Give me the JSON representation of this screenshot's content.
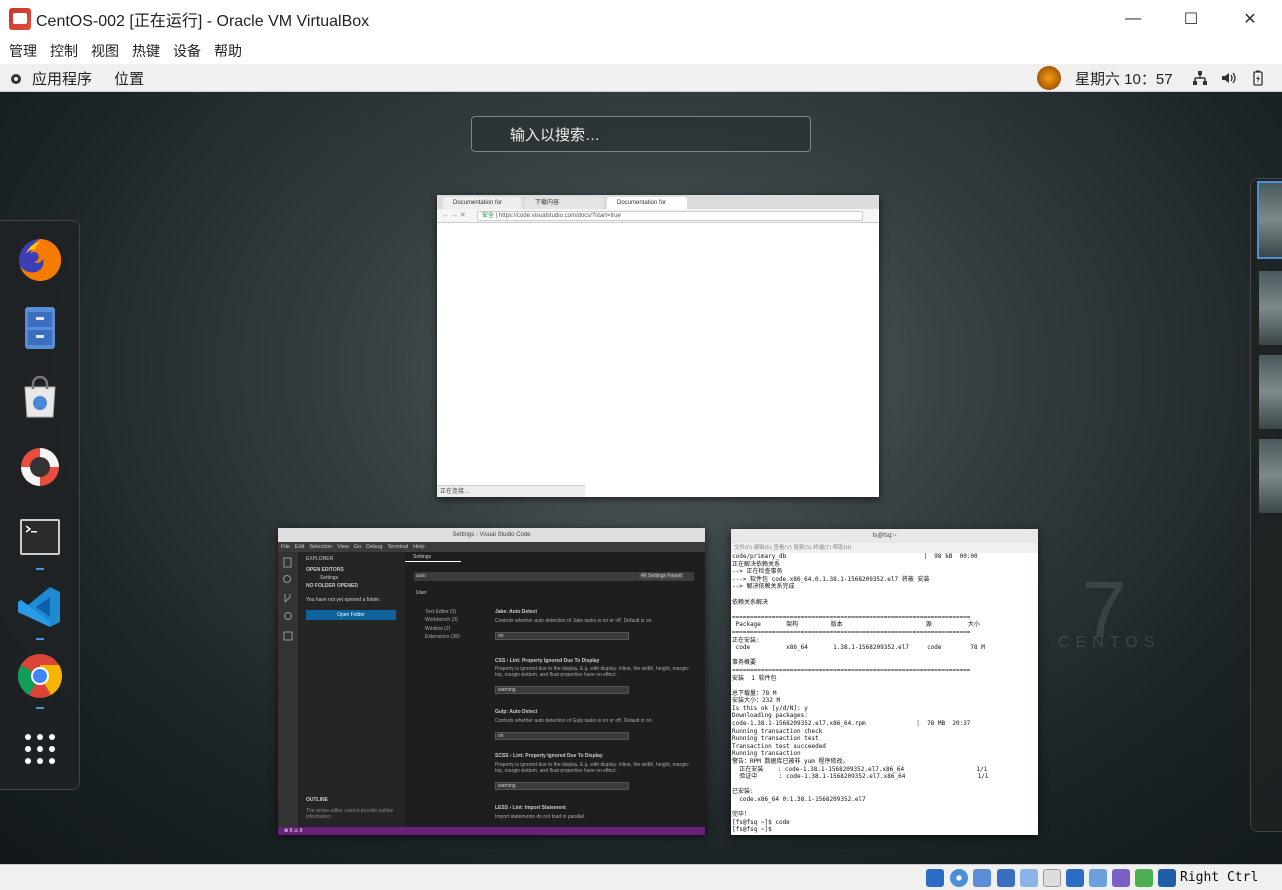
{
  "window": {
    "title": "CentOS-002 [正在运行] - Oracle VM VirtualBox",
    "minimize": "—",
    "maximize": "☐",
    "close": "✕"
  },
  "menubar": [
    "管理",
    "控制",
    "视图",
    "热键",
    "设备",
    "帮助"
  ],
  "guest_topbar": {
    "applications": "应用程序",
    "places": "位置",
    "clock": "星期六 10：57"
  },
  "search": {
    "placeholder": "输入以搜索…"
  },
  "chrome": {
    "tabs": [
      "Documentation for",
      "下载内容",
      "Documentation for"
    ],
    "secure_label": "安全",
    "url": "https://code.visualstudio.com/docs/?start=true",
    "status": "正在连接…"
  },
  "vscode": {
    "title": "Settings - Visual Studio Code",
    "menu": [
      "File",
      "Edit",
      "Selection",
      "View",
      "Go",
      "Debug",
      "Terminal",
      "Help"
    ],
    "explorer_label": "EXPLORER",
    "open_editors": "OPEN EDITORS",
    "open_editor_item": "Settings",
    "no_folder": "NO FOLDER OPENED",
    "no_folder_msg": "You have not yet opened a folder.",
    "open_folder_btn": "Open Folder",
    "outline": "OUTLINE",
    "outline_msg": "The active editor cannot provide outline information.",
    "tab": "Settings",
    "search_value": "auto",
    "found": "46 Settings Found",
    "user_tab": "User",
    "tree": [
      "Text Editor (3)",
      "Workbench (3)",
      "Window (2)",
      "Extensions (38)"
    ],
    "settings": [
      {
        "title": "Jake: Auto Detect",
        "desc": "Controls whether auto detection of Jake tasks is on or off. Default is on.",
        "value": "on"
      },
      {
        "title": "CSS › Lint: Property Ignored Due To Display",
        "desc": "Property is ignored due to the display. E.g. with display: inline, the width, height, margin-top, margin-bottom, and float properties have no effect.",
        "value": "warning"
      },
      {
        "title": "Gulp: Auto Detect",
        "desc": "Controls whether auto detection of Gulp tasks is on or off. Default is on.",
        "value": "on"
      },
      {
        "title": "SCSS › Lint: Property Ignored Due To Display",
        "desc": "Property is ignored due to the display. E.g. with display: inline, the width, height, margin-top, margin-bottom, and float properties have no effect.",
        "value": "warning"
      },
      {
        "title": "LESS › Lint: Import Statement",
        "desc": "Import statements do not load in parallel.",
        "value": ""
      }
    ],
    "status_left": "⊗ 0 ⚠ 0"
  },
  "terminal": {
    "title": "fs@fsq:~",
    "menu": "文件(F)  编辑(E)  查看(V)  搜索(S)  终端(T)  帮助(H)",
    "lines": [
      "code/primary_db                                      |  98 kB  00:00",
      "正在解决依赖关系",
      "--> 正在检查事务",
      "---> 软件包 code.x86_64.0.1.38.1-1568209352.el7 将被 安装",
      "--> 解决依赖关系完成",
      "",
      "依赖关系解决",
      "",
      "==================================================================",
      " Package       架构         版本                       源          大小",
      "==================================================================",
      "正在安装:",
      " code          x86_64       1.38.1-1568209352.el7     code        78 M",
      "",
      "事务概要",
      "==================================================================",
      "安装  1 软件包",
      "",
      "总下载量：78 M",
      "安装大小：232 M",
      "Is this ok [y/d/N]: y",
      "Downloading packages:",
      "code-1.38.1-1568209352.el7.x86_64.rpm              |  78 MB  20:37",
      "Running transaction check",
      "Running transaction test",
      "Transaction test succeeded",
      "Running transaction",
      "警告：RPM 数据库已被非 yum 程序修改。",
      "  正在安装    : code-1.38.1-1568209352.el7.x86_64                    1/1",
      "  验证中      : code-1.38.1-1568209352.el7.x86_64                    1/1",
      "",
      "已安装:",
      "  code.x86_64 0:1.38.1-1568209352.el7",
      "",
      "完毕！",
      "[fs@fsq ~]$ code",
      "[fs@fsq ~]$ "
    ]
  },
  "centos_mark": {
    "seven": "7",
    "word": "CENTOS"
  },
  "statusbar": {
    "host_key": "Right Ctrl"
  }
}
